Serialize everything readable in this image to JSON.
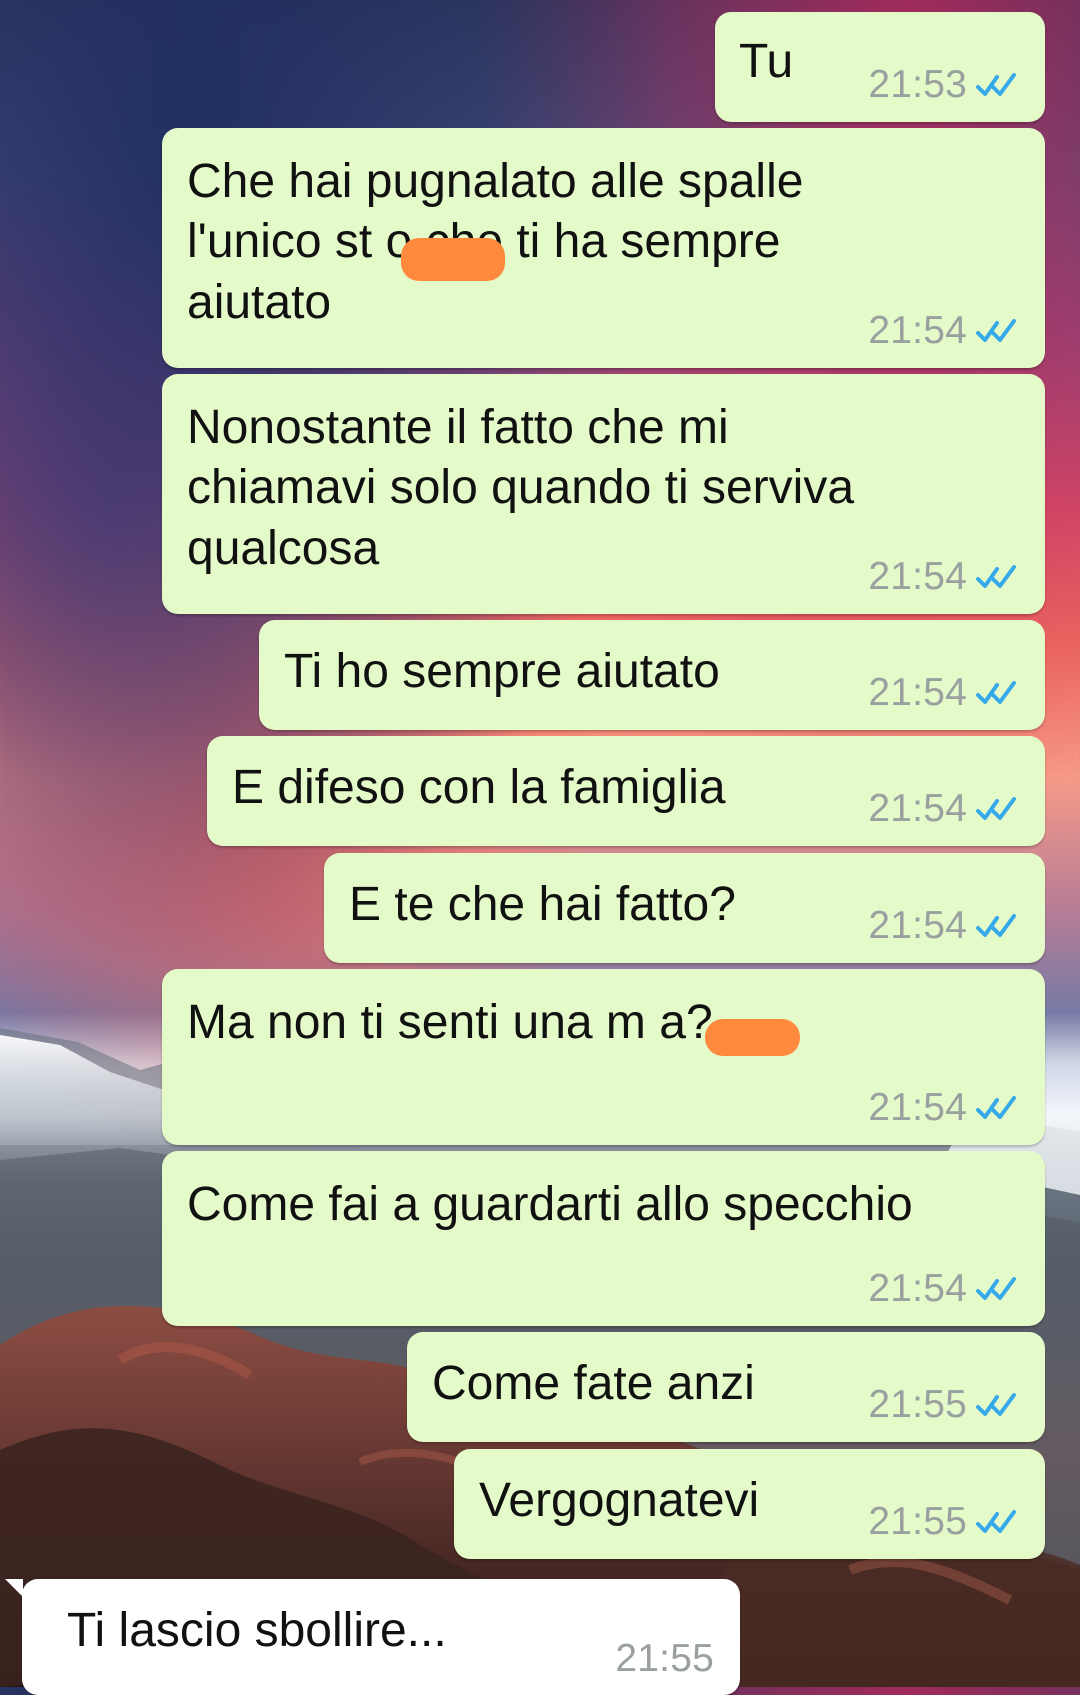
{
  "chat": {
    "messages": [
      {
        "direction": "outgoing",
        "text": "Tu",
        "time": "21:53",
        "status_icon": "double-check-icon"
      },
      {
        "direction": "outgoing",
        "text": "Che hai pugnalato alle spalle\nl'unico st o che ti ha sempre\naiutato",
        "time": "21:54",
        "status_icon": "double-check-icon"
      },
      {
        "direction": "outgoing",
        "text": "Nonostante il fatto che mi\nchiamavi solo quando ti serviva\nqualcosa",
        "time": "21:54",
        "status_icon": "double-check-icon"
      },
      {
        "direction": "outgoing",
        "text": "Ti ho sempre aiutato",
        "time": "21:54",
        "status_icon": "double-check-icon"
      },
      {
        "direction": "outgoing",
        "text": "E difeso con la famiglia",
        "time": "21:54",
        "status_icon": "double-check-icon"
      },
      {
        "direction": "outgoing",
        "text": "E te che hai fatto?",
        "time": "21:54",
        "status_icon": "double-check-icon"
      },
      {
        "direction": "outgoing",
        "text": "Ma non ti senti una m a?",
        "time": "21:54",
        "status_icon": "double-check-icon"
      },
      {
        "direction": "outgoing",
        "text": "Come fai a guardarti allo specchio",
        "time": "21:54",
        "status_icon": "double-check-icon"
      },
      {
        "direction": "outgoing",
        "text": "Come fate anzi",
        "time": "21:55",
        "status_icon": "double-check-icon"
      },
      {
        "direction": "outgoing",
        "text": "Vergognatevi",
        "time": "21:55",
        "status_icon": "double-check-icon"
      },
      {
        "direction": "incoming",
        "text": "Ti lascio sbollire...",
        "time": "21:55"
      }
    ]
  },
  "colors": {
    "outgoing_bubble": "#e4fbc9",
    "incoming_bubble": "#ffffff",
    "read_receipt": "#35a9ea",
    "timestamp": "#9aa0a0",
    "redaction": "#ff8a3d"
  }
}
